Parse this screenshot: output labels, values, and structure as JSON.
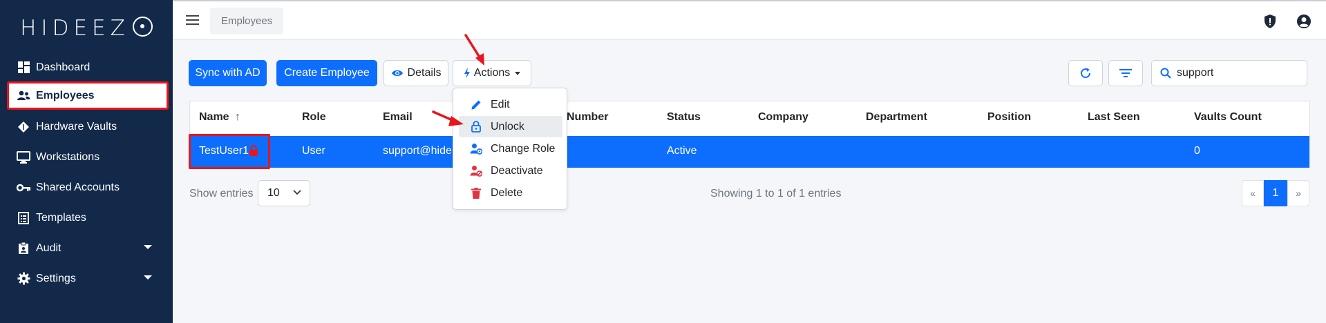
{
  "app": {
    "logo_text": "HIDEEZ",
    "brand_color": "#12294a",
    "accent_color": "#0d6efd",
    "highlight_color": "#e8161c"
  },
  "sidebar": {
    "items": [
      {
        "label": "Dashboard",
        "icon": "dashboard-icon"
      },
      {
        "label": "Employees",
        "icon": "users-icon",
        "active": true
      },
      {
        "label": "Hardware Vaults",
        "icon": "diamond-icon"
      },
      {
        "label": "Workstations",
        "icon": "monitor-icon"
      },
      {
        "label": "Shared Accounts",
        "icon": "key-icon"
      },
      {
        "label": "Templates",
        "icon": "list-icon"
      },
      {
        "label": "Audit",
        "icon": "clipboard-icon",
        "has_submenu": true
      },
      {
        "label": "Settings",
        "icon": "gear-icon",
        "has_submenu": true
      }
    ]
  },
  "topbar": {
    "breadcrumb": "Employees",
    "icons": [
      "shield-alert-icon",
      "user-account-icon"
    ]
  },
  "toolbar": {
    "sync_label": "Sync with AD",
    "create_label": "Create Employee",
    "details_label": "Details",
    "actions_label": "Actions",
    "refresh_icon": "refresh-icon",
    "filter_icon": "filter-icon",
    "search_value": "support"
  },
  "table": {
    "columns": [
      "Name",
      "Role",
      "Email",
      "Number",
      "Status",
      "Company",
      "Department",
      "Position",
      "Last Seen",
      "Vaults Count"
    ],
    "rows": [
      {
        "name": "TestUser1",
        "role": "User",
        "email": "support@hide",
        "number": "",
        "status": "Active",
        "company": "",
        "department": "",
        "position": "",
        "last_seen": "",
        "vaults_count": "0",
        "locked": true
      }
    ]
  },
  "actions_menu": {
    "items": [
      {
        "label": "Edit",
        "icon": "pencil-icon"
      },
      {
        "label": "Unlock",
        "icon": "unlock-icon",
        "hovered": true
      },
      {
        "label": "Change Role",
        "icon": "user-gear-icon"
      },
      {
        "label": "Deactivate",
        "icon": "user-block-icon"
      },
      {
        "label": "Delete",
        "icon": "trash-icon"
      }
    ]
  },
  "footer": {
    "show_entries_label": "Show entries",
    "page_size": "10",
    "showing_text": "Showing 1 to 1 of 1 entries",
    "pagination": {
      "prev": "«",
      "current": "1",
      "next": "»"
    }
  }
}
